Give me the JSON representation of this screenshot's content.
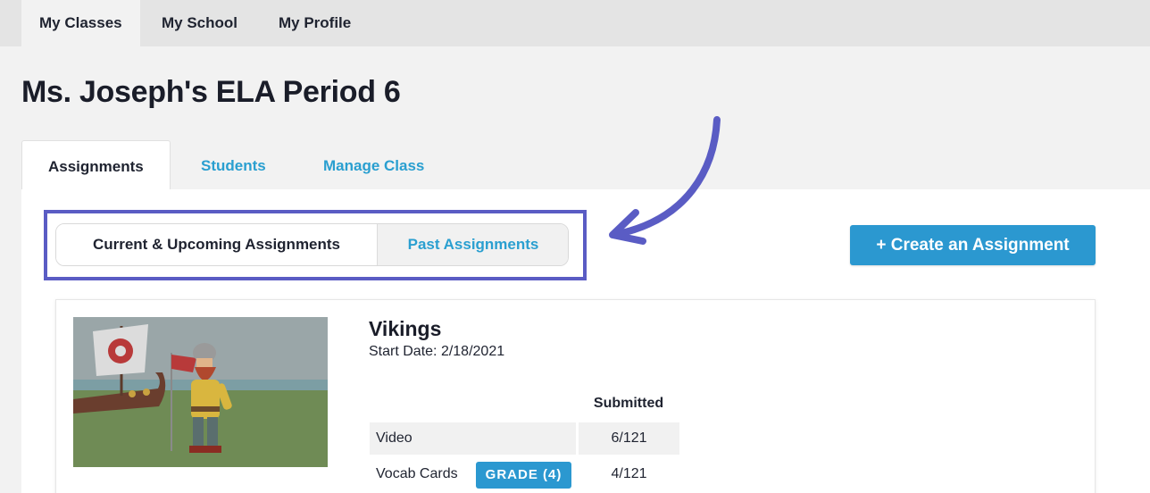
{
  "topnav": {
    "items": [
      {
        "label": "My Classes",
        "active": true
      },
      {
        "label": "My School",
        "active": false
      },
      {
        "label": "My Profile",
        "active": false
      }
    ]
  },
  "page": {
    "title": "Ms. Joseph's ELA Period 6"
  },
  "tabs": [
    {
      "label": "Assignments",
      "active": true
    },
    {
      "label": "Students",
      "active": false
    },
    {
      "label": "Manage Class",
      "active": false
    }
  ],
  "assignment_filter": {
    "current_label": "Current & Upcoming Assignments",
    "past_label": "Past Assignments",
    "selected": "Current & Upcoming Assignments"
  },
  "create_button": {
    "label": "+ Create an Assignment"
  },
  "assignment": {
    "title": "Vikings",
    "start_label": "Start Date:",
    "start_date": "2/18/2021",
    "table": {
      "column_header": "Submitted",
      "rows": [
        {
          "label": "Video",
          "submitted": "6/121"
        },
        {
          "label": "Vocab Cards",
          "submitted": "4/121",
          "badge": "GRADE (4)"
        }
      ]
    }
  },
  "colors": {
    "accent_blue": "#2b98d0",
    "highlight_purple": "#5a5cc4",
    "title_text": "#1a1d29"
  }
}
